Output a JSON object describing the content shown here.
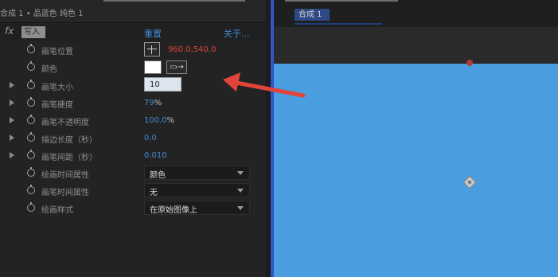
{
  "left_panel": {
    "header_title": "合成 1 • 品蓝色 纯色 1",
    "fx_symbol": "fx",
    "write_value": "写入",
    "reset_link": "重置",
    "about_link": "关于..."
  },
  "properties": [
    {
      "label": "画笔位置",
      "value": "960.0,540.0"
    },
    {
      "label": "颜色",
      "color": "#ffffff",
      "eyedropper": "▭→"
    },
    {
      "label": "画笔大小",
      "value": "10"
    },
    {
      "label": "画笔硬度",
      "value": "79",
      "unit": "%"
    },
    {
      "label": "画笔不透明度",
      "value": "100.0",
      "unit": "%"
    },
    {
      "label": "描边长度（秒）",
      "value": "0.0"
    },
    {
      "label": "画笔间距（秒）",
      "value": "0.010"
    },
    {
      "label": "绘画时间属性",
      "value": "颜色"
    },
    {
      "label": "画笔时间属性",
      "value": "无"
    },
    {
      "label": "绘画样式",
      "value": "在原始图像上"
    }
  ],
  "right_panel": {
    "comp_tab": "合成 1",
    "solid_color": "#4a9ee0"
  },
  "annotation": {
    "arrow_color": "#e2443a"
  }
}
